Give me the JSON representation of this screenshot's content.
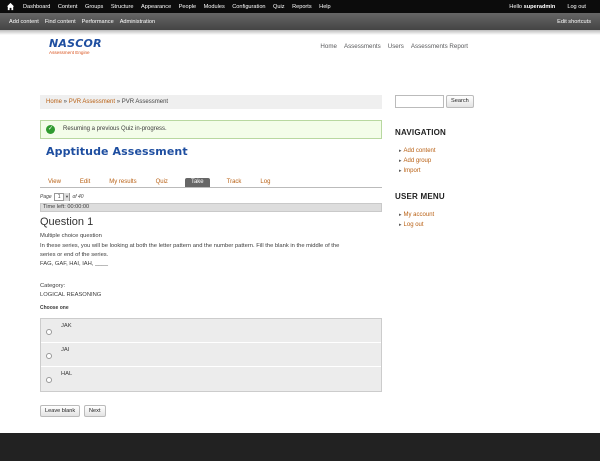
{
  "toolbar": {
    "menu": [
      "Dashboard",
      "Content",
      "Groups",
      "Structure",
      "Appearance",
      "People",
      "Modules",
      "Configuration",
      "Quiz",
      "Reports",
      "Help"
    ],
    "hello_prefix": "Hello ",
    "user": "superadmin",
    "logout": "Log out"
  },
  "shortcuts": {
    "links": [
      "Add content",
      "Find content",
      "Performance",
      "Administration"
    ],
    "edit": "Edit shortcuts"
  },
  "site": {
    "logo_title": "NASCOR",
    "logo_subtitle": "Assessment Engine",
    "nav": [
      "Home",
      "Assessments",
      "Users",
      "Assessments Report"
    ]
  },
  "breadcrumb": {
    "home": "Home",
    "sep": " » ",
    "parent": "PVR Assessment",
    "current": "PVR Assessment"
  },
  "status_message": "Resuming a previous Quiz in-progress.",
  "page_title": "Apptitude Assessment",
  "tabs": [
    "View",
    "Edit",
    "My results",
    "Quiz",
    "Take",
    "Track",
    "Log"
  ],
  "active_tab": "Take",
  "pager": {
    "label": "Page",
    "current": "1",
    "of_text": "of 40"
  },
  "time_left": "Time left: 00:00:00",
  "question": {
    "title": "Question 1",
    "type": "Multiple choice question",
    "body_line1": "In these series, you will be looking at both the letter pattern and the number pattern. Fill the blank in the middle of the",
    "body_line2": "series or end of the series.",
    "body_line3": "FAG, GAF, HAI, IAH, ____",
    "category_label": "Category:",
    "category": "LOGICAL REASONING",
    "choose": "Choose one",
    "choices": [
      "JAK",
      "JAI",
      "HAL"
    ]
  },
  "buttons": {
    "leave_blank": "Leave blank",
    "next": "Next"
  },
  "sidebar": {
    "search_button": "Search",
    "navigation_title": "NAVIGATION",
    "navigation_items": [
      "Add content",
      "Add group",
      "Import"
    ],
    "user_menu_title": "USER MENU",
    "user_menu_items": [
      "My account",
      "Log out"
    ]
  },
  "colors": {
    "accent": "#b85f12",
    "title_blue": "#1e4ea0",
    "toolbar": "#0c0c0c",
    "footer": "#222222"
  }
}
